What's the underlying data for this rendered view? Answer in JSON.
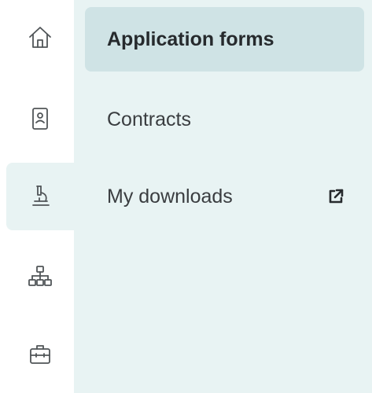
{
  "rail": {
    "items": [
      {
        "icon": "home-icon",
        "active": false
      },
      {
        "icon": "contact-card-icon",
        "active": false
      },
      {
        "icon": "microscope-icon",
        "active": true
      },
      {
        "icon": "org-chart-icon",
        "active": false
      },
      {
        "icon": "toolbox-icon",
        "active": false
      }
    ]
  },
  "submenu": {
    "items": [
      {
        "label": "Application forms",
        "selected": true,
        "external": false
      },
      {
        "label": "Contracts",
        "selected": false,
        "external": false
      },
      {
        "label": "My downloads",
        "selected": false,
        "external": true,
        "external_icon": "external-link-icon"
      }
    ]
  },
  "colors": {
    "panel_bg": "#e8f3f3",
    "selected_bg": "#cfe3e5",
    "icon_stroke": "#505558",
    "text": "#3a3d40"
  }
}
